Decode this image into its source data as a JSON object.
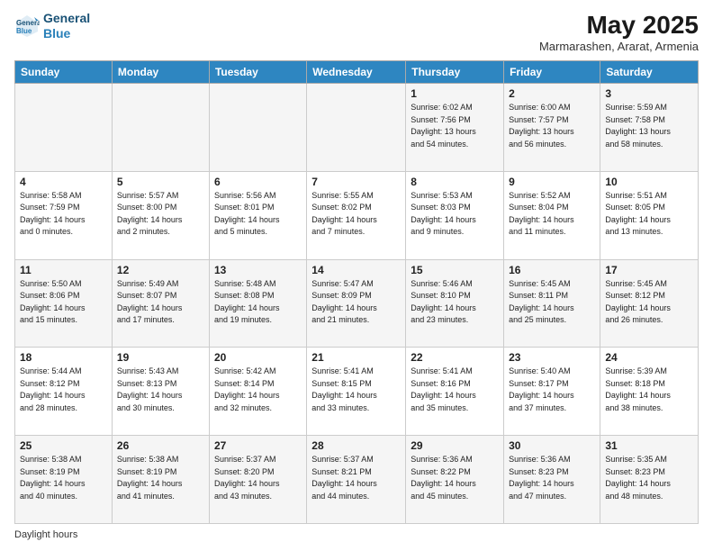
{
  "logo": {
    "line1": "General",
    "line2": "Blue"
  },
  "title": "May 2025",
  "subtitle": "Marmarashen, Ararat, Armenia",
  "days_of_week": [
    "Sunday",
    "Monday",
    "Tuesday",
    "Wednesday",
    "Thursday",
    "Friday",
    "Saturday"
  ],
  "weeks": [
    [
      {
        "day": "",
        "info": ""
      },
      {
        "day": "",
        "info": ""
      },
      {
        "day": "",
        "info": ""
      },
      {
        "day": "",
        "info": ""
      },
      {
        "day": "1",
        "info": "Sunrise: 6:02 AM\nSunset: 7:56 PM\nDaylight: 13 hours\nand 54 minutes."
      },
      {
        "day": "2",
        "info": "Sunrise: 6:00 AM\nSunset: 7:57 PM\nDaylight: 13 hours\nand 56 minutes."
      },
      {
        "day": "3",
        "info": "Sunrise: 5:59 AM\nSunset: 7:58 PM\nDaylight: 13 hours\nand 58 minutes."
      }
    ],
    [
      {
        "day": "4",
        "info": "Sunrise: 5:58 AM\nSunset: 7:59 PM\nDaylight: 14 hours\nand 0 minutes."
      },
      {
        "day": "5",
        "info": "Sunrise: 5:57 AM\nSunset: 8:00 PM\nDaylight: 14 hours\nand 2 minutes."
      },
      {
        "day": "6",
        "info": "Sunrise: 5:56 AM\nSunset: 8:01 PM\nDaylight: 14 hours\nand 5 minutes."
      },
      {
        "day": "7",
        "info": "Sunrise: 5:55 AM\nSunset: 8:02 PM\nDaylight: 14 hours\nand 7 minutes."
      },
      {
        "day": "8",
        "info": "Sunrise: 5:53 AM\nSunset: 8:03 PM\nDaylight: 14 hours\nand 9 minutes."
      },
      {
        "day": "9",
        "info": "Sunrise: 5:52 AM\nSunset: 8:04 PM\nDaylight: 14 hours\nand 11 minutes."
      },
      {
        "day": "10",
        "info": "Sunrise: 5:51 AM\nSunset: 8:05 PM\nDaylight: 14 hours\nand 13 minutes."
      }
    ],
    [
      {
        "day": "11",
        "info": "Sunrise: 5:50 AM\nSunset: 8:06 PM\nDaylight: 14 hours\nand 15 minutes."
      },
      {
        "day": "12",
        "info": "Sunrise: 5:49 AM\nSunset: 8:07 PM\nDaylight: 14 hours\nand 17 minutes."
      },
      {
        "day": "13",
        "info": "Sunrise: 5:48 AM\nSunset: 8:08 PM\nDaylight: 14 hours\nand 19 minutes."
      },
      {
        "day": "14",
        "info": "Sunrise: 5:47 AM\nSunset: 8:09 PM\nDaylight: 14 hours\nand 21 minutes."
      },
      {
        "day": "15",
        "info": "Sunrise: 5:46 AM\nSunset: 8:10 PM\nDaylight: 14 hours\nand 23 minutes."
      },
      {
        "day": "16",
        "info": "Sunrise: 5:45 AM\nSunset: 8:11 PM\nDaylight: 14 hours\nand 25 minutes."
      },
      {
        "day": "17",
        "info": "Sunrise: 5:45 AM\nSunset: 8:12 PM\nDaylight: 14 hours\nand 26 minutes."
      }
    ],
    [
      {
        "day": "18",
        "info": "Sunrise: 5:44 AM\nSunset: 8:12 PM\nDaylight: 14 hours\nand 28 minutes."
      },
      {
        "day": "19",
        "info": "Sunrise: 5:43 AM\nSunset: 8:13 PM\nDaylight: 14 hours\nand 30 minutes."
      },
      {
        "day": "20",
        "info": "Sunrise: 5:42 AM\nSunset: 8:14 PM\nDaylight: 14 hours\nand 32 minutes."
      },
      {
        "day": "21",
        "info": "Sunrise: 5:41 AM\nSunset: 8:15 PM\nDaylight: 14 hours\nand 33 minutes."
      },
      {
        "day": "22",
        "info": "Sunrise: 5:41 AM\nSunset: 8:16 PM\nDaylight: 14 hours\nand 35 minutes."
      },
      {
        "day": "23",
        "info": "Sunrise: 5:40 AM\nSunset: 8:17 PM\nDaylight: 14 hours\nand 37 minutes."
      },
      {
        "day": "24",
        "info": "Sunrise: 5:39 AM\nSunset: 8:18 PM\nDaylight: 14 hours\nand 38 minutes."
      }
    ],
    [
      {
        "day": "25",
        "info": "Sunrise: 5:38 AM\nSunset: 8:19 PM\nDaylight: 14 hours\nand 40 minutes."
      },
      {
        "day": "26",
        "info": "Sunrise: 5:38 AM\nSunset: 8:19 PM\nDaylight: 14 hours\nand 41 minutes."
      },
      {
        "day": "27",
        "info": "Sunrise: 5:37 AM\nSunset: 8:20 PM\nDaylight: 14 hours\nand 43 minutes."
      },
      {
        "day": "28",
        "info": "Sunrise: 5:37 AM\nSunset: 8:21 PM\nDaylight: 14 hours\nand 44 minutes."
      },
      {
        "day": "29",
        "info": "Sunrise: 5:36 AM\nSunset: 8:22 PM\nDaylight: 14 hours\nand 45 minutes."
      },
      {
        "day": "30",
        "info": "Sunrise: 5:36 AM\nSunset: 8:23 PM\nDaylight: 14 hours\nand 47 minutes."
      },
      {
        "day": "31",
        "info": "Sunrise: 5:35 AM\nSunset: 8:23 PM\nDaylight: 14 hours\nand 48 minutes."
      }
    ]
  ],
  "footer": "Daylight hours"
}
